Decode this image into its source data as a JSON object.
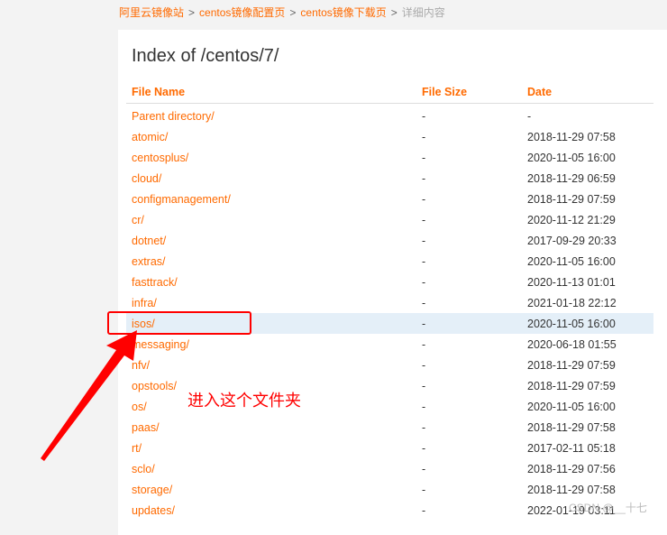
{
  "breadcrumb": {
    "items": [
      "阿里云镜像站",
      "centos镜像配置页",
      "centos镜像下载页"
    ],
    "current": "详细内容",
    "separator": ">"
  },
  "page": {
    "title": "Index of /centos/7/"
  },
  "table": {
    "headers": {
      "name": "File Name",
      "size": "File Size",
      "date": "Date"
    },
    "rows": [
      {
        "name": "Parent directory/",
        "size": "-",
        "date": "-"
      },
      {
        "name": "atomic/",
        "size": "-",
        "date": "2018-11-29 07:58"
      },
      {
        "name": "centosplus/",
        "size": "-",
        "date": "2020-11-05 16:00"
      },
      {
        "name": "cloud/",
        "size": "-",
        "date": "2018-11-29 06:59"
      },
      {
        "name": "configmanagement/",
        "size": "-",
        "date": "2018-11-29 07:59"
      },
      {
        "name": "cr/",
        "size": "-",
        "date": "2020-11-12 21:29"
      },
      {
        "name": "dotnet/",
        "size": "-",
        "date": "2017-09-29 20:33"
      },
      {
        "name": "extras/",
        "size": "-",
        "date": "2020-11-05 16:00"
      },
      {
        "name": "fasttrack/",
        "size": "-",
        "date": "2020-11-13 01:01"
      },
      {
        "name": "infra/",
        "size": "-",
        "date": "2021-01-18 22:12"
      },
      {
        "name": "isos/",
        "size": "-",
        "date": "2020-11-05 16:00"
      },
      {
        "name": "messaging/",
        "size": "-",
        "date": "2020-06-18 01:55"
      },
      {
        "name": "nfv/",
        "size": "-",
        "date": "2018-11-29 07:59"
      },
      {
        "name": "opstools/",
        "size": "-",
        "date": "2018-11-29 07:59"
      },
      {
        "name": "os/",
        "size": "-",
        "date": "2020-11-05 16:00"
      },
      {
        "name": "paas/",
        "size": "-",
        "date": "2018-11-29 07:58"
      },
      {
        "name": "rt/",
        "size": "-",
        "date": "2017-02-11 05:18"
      },
      {
        "name": "sclo/",
        "size": "-",
        "date": "2018-11-29 07:56"
      },
      {
        "name": "storage/",
        "size": "-",
        "date": "2018-11-29 07:58"
      },
      {
        "name": "updates/",
        "size": "-",
        "date": "2022-01-19 03:11"
      }
    ]
  },
  "annotation": {
    "text": "进入这个文件夹",
    "color": "#ff0000"
  },
  "watermark": "CSDN @__十七",
  "colors": {
    "accent": "#ff6a00",
    "highlight": "#e4eff8"
  }
}
